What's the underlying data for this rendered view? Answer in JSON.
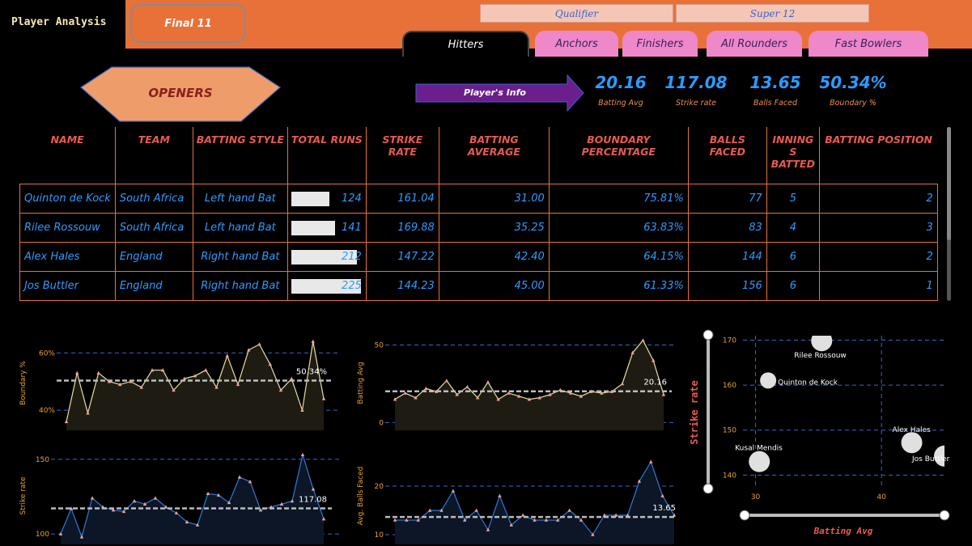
{
  "header": {
    "title": "Player Analysis",
    "final_button": "Final 11",
    "slicers": [
      "Qualifier",
      "Super 12"
    ],
    "tabs": [
      {
        "label": "Hitters",
        "active": true
      },
      {
        "label": "Anchors",
        "active": false
      },
      {
        "label": "Finishers",
        "active": false
      },
      {
        "label": "All Rounders",
        "active": false
      },
      {
        "label": "Fast Bowlers",
        "active": false
      }
    ]
  },
  "section": {
    "label": "OPENERS",
    "info_button": "Player's Info"
  },
  "kpis": [
    {
      "value": "20.16",
      "label": "Batting Avg"
    },
    {
      "value": "117.08",
      "label": "Strike rate"
    },
    {
      "value": "13.65",
      "label": "Balls Faced"
    },
    {
      "value": "50.34%",
      "label": "Boundary %"
    }
  ],
  "table": {
    "headers": [
      "NAME",
      "TEAM",
      "BATTING STYLE",
      "TOTAL RUNS",
      "STRIKE RATE",
      "BATTING AVERAGE",
      "BOUNDARY PERCENTAGE",
      "BALLS FACED",
      "INNING S BATTED",
      "BATTING POSITION"
    ],
    "rows": [
      {
        "name": "Quinton de Kock",
        "team": "South Africa",
        "style": "Left hand Bat",
        "runs": "124",
        "runs_fraction": 0.55,
        "sr": "161.04",
        "avg": "31.00",
        "bp": "75.81%",
        "bf": "77",
        "inn": "5",
        "pos": "2"
      },
      {
        "name": "Rilee Rossouw",
        "team": "South Africa",
        "style": "Left hand Bat",
        "runs": "141",
        "runs_fraction": 0.63,
        "sr": "169.88",
        "avg": "35.25",
        "bp": "63.83%",
        "bf": "83",
        "inn": "4",
        "pos": "3"
      },
      {
        "name": "Alex Hales",
        "team": "England",
        "style": "Right hand Bat",
        "runs": "212",
        "runs_fraction": 0.94,
        "sr": "147.22",
        "avg": "42.40",
        "bp": "64.15%",
        "bf": "144",
        "inn": "6",
        "pos": "2"
      },
      {
        "name": "Jos Buttler",
        "team": "England",
        "style": "Right hand Bat",
        "runs": "225",
        "runs_fraction": 1.0,
        "sr": "144.23",
        "avg": "45.00",
        "bp": "61.33%",
        "bf": "156",
        "inn": "6",
        "pos": "1"
      }
    ]
  },
  "colors": {
    "accent": "#E8713A",
    "value_blue": "#2E9BFF",
    "header_red": "#E85A50",
    "tab_pink": "#EE88C8",
    "axis_orange": "#E8A030"
  },
  "chart_data": [
    {
      "type": "area",
      "ylabel": "Boundary %",
      "ticks": [
        "60%",
        "40%"
      ],
      "ylim": [
        33,
        66
      ],
      "avg": 50.34,
      "avg_label": "50.34%",
      "values": [
        36,
        53,
        39,
        53,
        50,
        49,
        50,
        48,
        54,
        54,
        47,
        51,
        52,
        54,
        48,
        59,
        49,
        61,
        63,
        56,
        47,
        51,
        40,
        64,
        44
      ]
    },
    {
      "type": "area",
      "ylabel": "Batting Avg",
      "ticks": [
        "50",
        "0"
      ],
      "ylim": [
        -5,
        56
      ],
      "avg": 20.16,
      "avg_label": "20.16",
      "values": [
        15,
        19,
        16,
        22,
        20,
        27,
        18,
        23,
        16,
        26,
        15,
        19,
        17,
        15,
        16,
        18,
        21,
        19,
        17,
        20,
        19,
        20,
        25,
        45,
        53,
        40,
        18
      ]
    },
    {
      "type": "area",
      "ylabel": "Strike rate",
      "ticks": [
        "150",
        "100"
      ],
      "ylim": [
        93,
        158
      ],
      "avg": 117.08,
      "avg_label": "117.08",
      "values": [
        100,
        117,
        98,
        124,
        118,
        116,
        115,
        122,
        120,
        124,
        118,
        114,
        108,
        106,
        127,
        126,
        121,
        138,
        135,
        116,
        118,
        120,
        122,
        153,
        130,
        110
      ]
    },
    {
      "type": "area",
      "ylabel": "Avg. Balls Faced",
      "ticks": [
        "20",
        "10"
      ],
      "ylim": [
        8,
        28
      ],
      "avg": 13.65,
      "avg_label": "13.65",
      "values": [
        13,
        13,
        13,
        15,
        15,
        19,
        13,
        15,
        11,
        18,
        12,
        14,
        13,
        13,
        13,
        15,
        13,
        10,
        14,
        14,
        14,
        21,
        25,
        18,
        14
      ]
    },
    {
      "type": "scatter",
      "xlabel": "Batting Avg",
      "ylabel": "Strike rate",
      "xticks": [
        "30",
        "40"
      ],
      "yticks": [
        "170",
        "160",
        "150",
        "140"
      ],
      "xlim": [
        29,
        45
      ],
      "ylim": [
        137,
        171
      ],
      "points": [
        {
          "name": "Rilee Rossouw",
          "x": 35.25,
          "y": 169.88
        },
        {
          "name": "Quinton de Kock",
          "x": 31.0,
          "y": 161.04
        },
        {
          "name": "Alex Hales",
          "x": 42.4,
          "y": 147.22
        },
        {
          "name": "Jos Buttler",
          "x": 45.0,
          "y": 144.23
        },
        {
          "name": "Kusal Mendis",
          "x": 30.3,
          "y": 143.0
        }
      ]
    }
  ]
}
